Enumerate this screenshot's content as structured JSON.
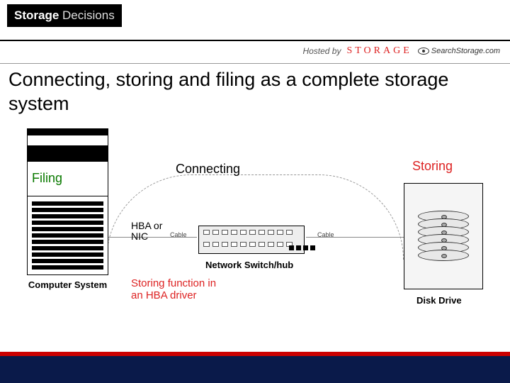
{
  "header": {
    "logo_strong": "Storage",
    "logo_light": " Decisions"
  },
  "hosted": {
    "label": "Hosted by",
    "brand": "STORAGE",
    "search": "SearchStorage.com"
  },
  "title": "Connecting, storing and filing as a complete storage system",
  "diagram": {
    "filing": "Filing",
    "computer_label": "Computer System",
    "connecting": "Connecting",
    "hba_l1": "HBA or",
    "hba_l2": "NIC",
    "cable": "Cable",
    "switch_label": "Network Switch/hub",
    "storing_fn_l1": "Storing function in",
    "storing_fn_l2": "an HBA  driver",
    "storing": "Storing",
    "disk_label": "Disk Drive"
  }
}
